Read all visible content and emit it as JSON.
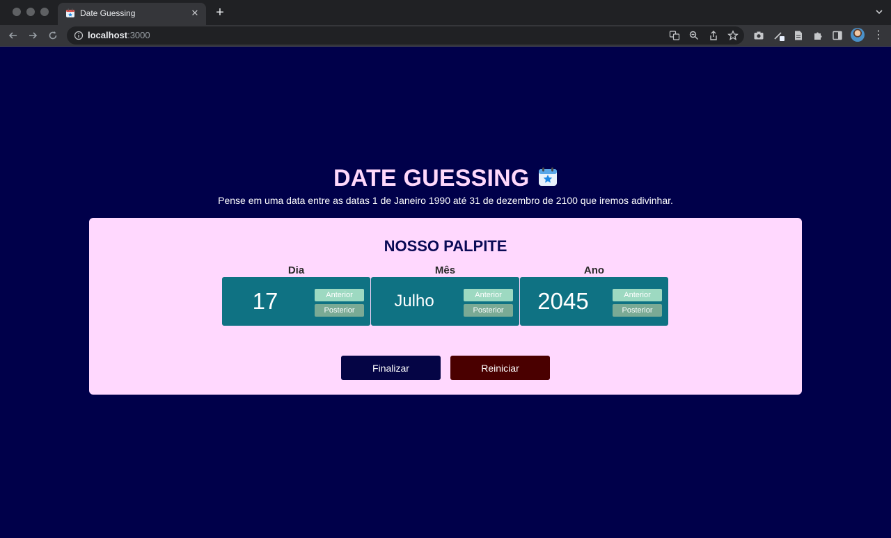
{
  "browser": {
    "tab_title": "Date Guessing",
    "url_host": "localhost",
    "url_port": ":3000"
  },
  "page": {
    "title": "DATE GUESSING",
    "subtitle": "Pense em uma data entre as datas 1 de Janeiro 1990 até 31 de dezembro de 2100 que iremos adivinhar.",
    "card_title": "NOSSO PALPITE",
    "columns": [
      {
        "label": "Dia",
        "value": "17",
        "prev_label": "Anterior",
        "next_label": "Posterior"
      },
      {
        "label": "Mês",
        "value": "Julho",
        "prev_label": "Anterior",
        "next_label": "Posterior"
      },
      {
        "label": "Ano",
        "value": "2045",
        "prev_label": "Anterior",
        "next_label": "Posterior"
      }
    ],
    "finalize_label": "Finalizar",
    "reset_label": "Reiniciar"
  },
  "icons": {
    "title_emoji": "calendar-icon",
    "tab_favicon": "calendar-icon"
  },
  "colors": {
    "background": "#00004a",
    "title": "#ffd8fb",
    "card": "#ffd8fe",
    "box": "#0f7283",
    "finalize": "#050545",
    "reset": "#4a0000"
  }
}
